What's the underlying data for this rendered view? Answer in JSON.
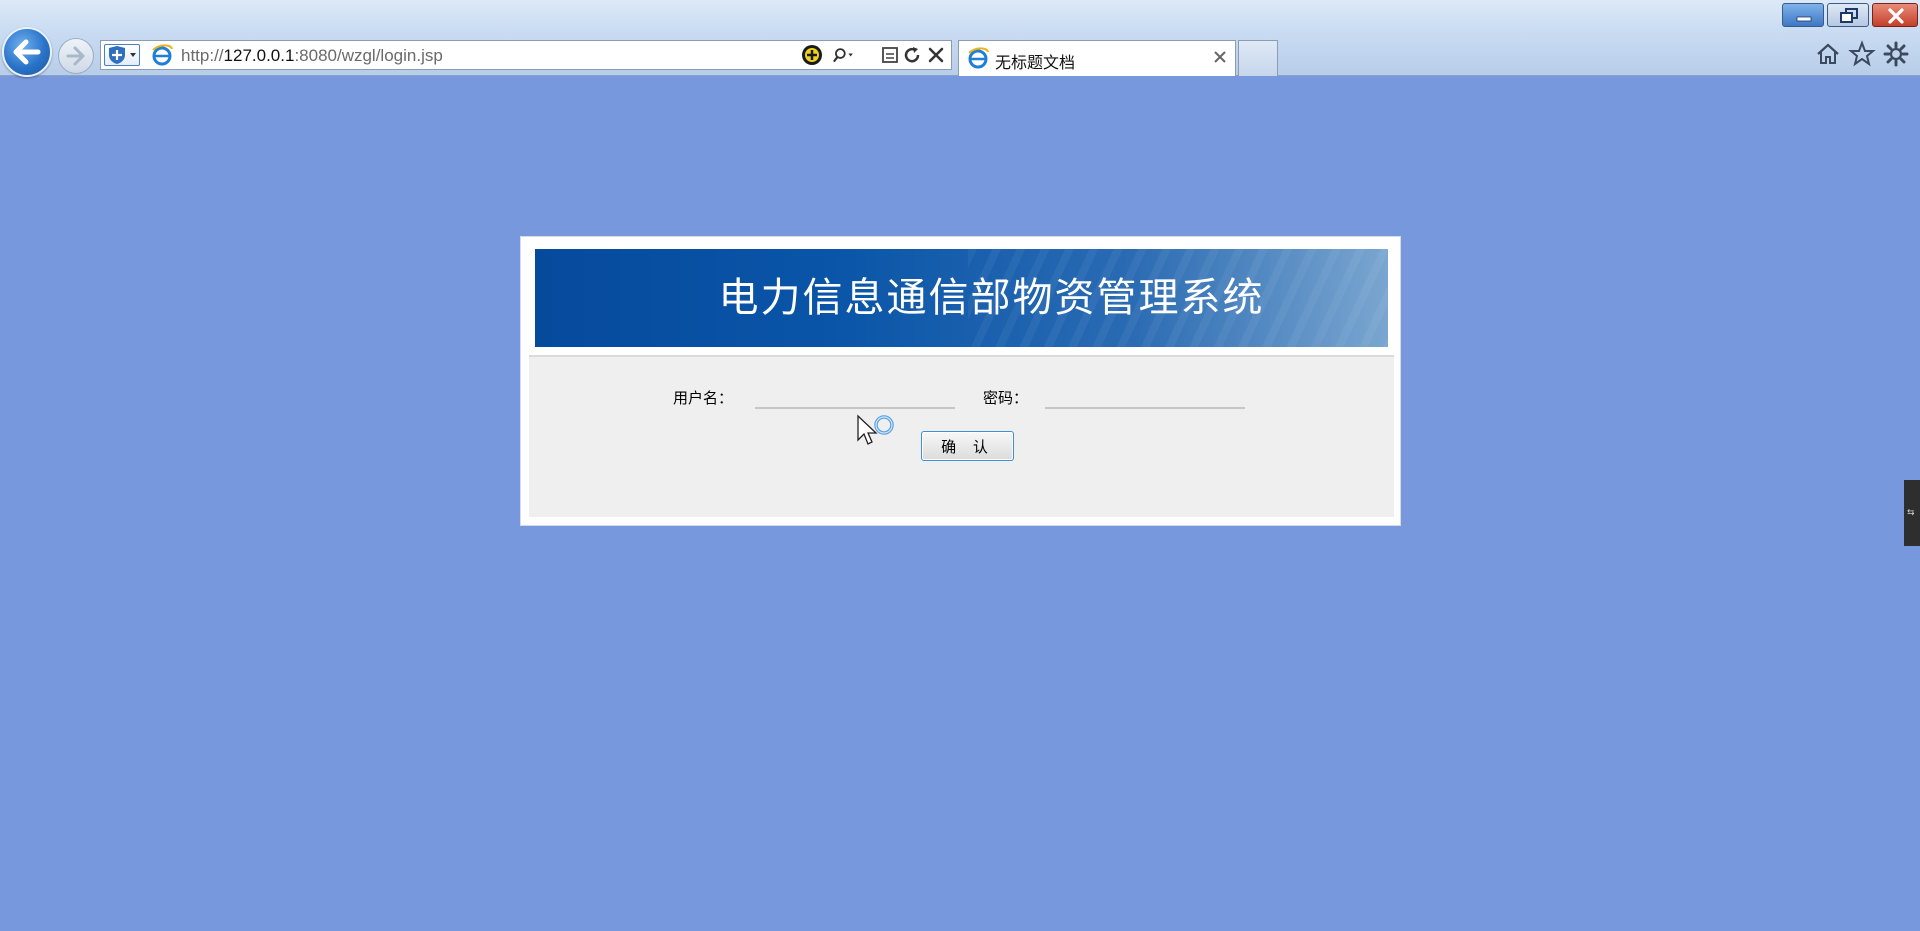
{
  "browser": {
    "url_prefix": "http://",
    "url_host": "127.0.0.1",
    "url_path": ":8080/wzgl/login.jsp",
    "tab_title": "无标题文档"
  },
  "login": {
    "system_title": "电力信息通信部物资管理系统",
    "username_label": "用户名：",
    "username_value": "",
    "password_label": "密码：",
    "password_value": "",
    "submit_label": "确 认"
  },
  "side_tab": {
    "label": "⇆"
  },
  "colors": {
    "page_background": "#7898de",
    "banner_dark": "#064a9c",
    "banner_light": "#7aa6d0",
    "form_panel": "#efefef",
    "button_border": "#3c8fd8"
  },
  "icons": {
    "back": "back-arrow-icon",
    "forward": "forward-arrow-icon",
    "shield": "security-shield-icon",
    "ie": "ie-logo-icon",
    "compat": "compatibility-icon",
    "search": "search-icon",
    "refresh": "refresh-icon",
    "stop": "stop-icon",
    "home": "home-icon",
    "favorites": "favorites-star-icon",
    "tools": "gear-icon"
  }
}
